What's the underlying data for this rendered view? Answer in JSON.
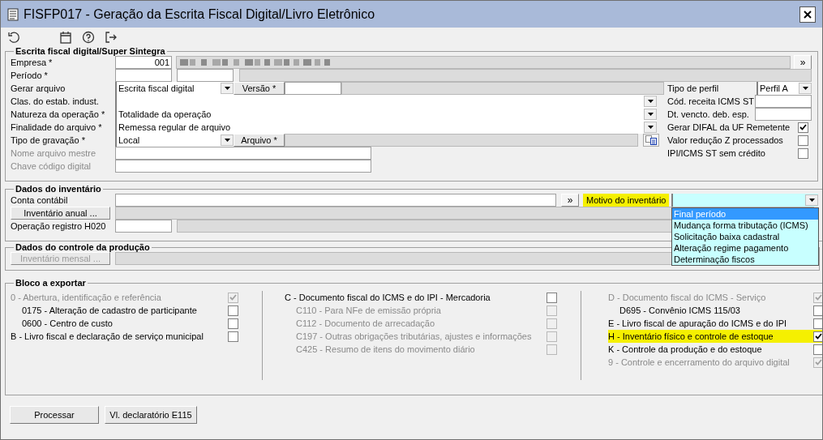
{
  "window": {
    "title": "FISFP017 - Geração da Escrita Fiscal Digital/Livro Eletrônico"
  },
  "escrita": {
    "title": "Escrita fiscal digital/Super Sintegra",
    "empresa": {
      "label": "Empresa *",
      "code": "001",
      "more": "»"
    },
    "periodo": {
      "label": "Período *"
    },
    "gerar_arquivo": {
      "label": "Gerar arquivo",
      "value": "Escrita fiscal digital"
    },
    "versao": {
      "label": "Versão *"
    },
    "clas_estab": {
      "label": "Clas. do estab. indust."
    },
    "natureza": {
      "label": "Natureza da operação *",
      "value": "Totalidade da operação"
    },
    "finalidade": {
      "label": "Finalidade do arquivo *",
      "value": "Remessa regular de arquivo"
    },
    "tipo_gravacao": {
      "label": "Tipo de gravação *",
      "value": "Local"
    },
    "arquivo": {
      "label": "Arquivo *"
    },
    "nome_arquivo_mestre": {
      "label": "Nome arquivo mestre",
      "disabled": true
    },
    "chave_codigo": {
      "label": "Chave código digital",
      "disabled": true
    },
    "right_fields": [
      {
        "kind": "select",
        "label": "Tipo de perfil",
        "value": "Perfil A"
      },
      {
        "kind": "input",
        "label": "Cód. receita ICMS ST"
      },
      {
        "kind": "input",
        "label": "Dt. vencto. deb. esp."
      },
      {
        "kind": "checkbox",
        "label": "Gerar DIFAL da UF Remetente",
        "checked": true
      },
      {
        "kind": "checkbox",
        "label": "Valor redução Z processados",
        "checked": false
      },
      {
        "kind": "checkbox",
        "label": "IPI/ICMS ST sem crédito",
        "checked": false
      }
    ]
  },
  "inventario": {
    "title": "Dados do inventário",
    "conta": {
      "label": "Conta contábil",
      "more": "»"
    },
    "motivo": {
      "label": "Motivo do inventário",
      "expanded": true,
      "options": [
        {
          "label": "Final período",
          "selected": true
        },
        {
          "label": "Mudança forma tributação (ICMS)",
          "selected": false
        },
        {
          "label": "Solicitação baixa cadastral",
          "selected": false
        },
        {
          "label": "Alteração regime pagamento",
          "selected": false
        },
        {
          "label": "Determinação fiscos",
          "selected": false
        }
      ]
    },
    "inventario_anual": {
      "label": "Inventário anual ..."
    },
    "operacao": {
      "label": "Operação registro H020"
    }
  },
  "producao": {
    "title": "Dados do controle da produção",
    "inventario_mensal": {
      "label": "Inventário mensal ...",
      "disabled": true
    }
  },
  "bloco": {
    "title": "Bloco a exportar",
    "columns": [
      [
        {
          "label": "0 - Abertura, identificação e referência",
          "checked": true,
          "disabled": true,
          "highlighted": false,
          "children": [
            {
              "label": "0175 - Alteração de cadastro de participante",
              "checked": false,
              "disabled": false,
              "highlighted": false
            },
            {
              "label": "0600 - Centro de custo",
              "checked": false,
              "disabled": false,
              "highlighted": false
            }
          ]
        },
        {
          "label": "B - Livro fiscal e declaração de serviço municipal",
          "checked": false,
          "disabled": false,
          "highlighted": false
        }
      ],
      [
        {
          "label": "C - Documento fiscal do ICMS e do IPI - Mercadoria",
          "checked": false,
          "disabled": false,
          "highlighted": false,
          "children": [
            {
              "label": "C110 - Para NFe de emissão própria",
              "checked": false,
              "disabled": true,
              "highlighted": false
            },
            {
              "label": "C112 - Documento de arrecadação",
              "checked": false,
              "disabled": true,
              "highlighted": false
            },
            {
              "label": "C197 - Outras obrigações tributárias, ajustes e informações",
              "checked": false,
              "disabled": true,
              "highlighted": false
            },
            {
              "label": "C425 - Resumo de itens do movimento diário",
              "checked": false,
              "disabled": true,
              "highlighted": false
            }
          ]
        }
      ],
      [
        {
          "label": "D - Documento fiscal do ICMS - Serviço",
          "checked": true,
          "disabled": true,
          "highlighted": false,
          "children": [
            {
              "label": "D695 - Convênio ICMS 115/03",
              "checked": false,
              "disabled": false,
              "highlighted": false
            }
          ]
        },
        {
          "label": "E - Livro fiscal de apuração do ICMS e do IPI",
          "checked": false,
          "disabled": false,
          "highlighted": false
        },
        {
          "label": "H - Inventário físico e controle de estoque",
          "checked": true,
          "disabled": false,
          "highlighted": true
        },
        {
          "label": "K - Controle da produção e do estoque",
          "checked": false,
          "disabled": false,
          "highlighted": false
        },
        {
          "label": "9 - Controle e encerramento do arquivo digital",
          "checked": true,
          "disabled": true,
          "highlighted": false
        }
      ]
    ]
  },
  "buttons": [
    {
      "label": "Processar"
    },
    {
      "label": "Vl. declaratório E115"
    }
  ]
}
